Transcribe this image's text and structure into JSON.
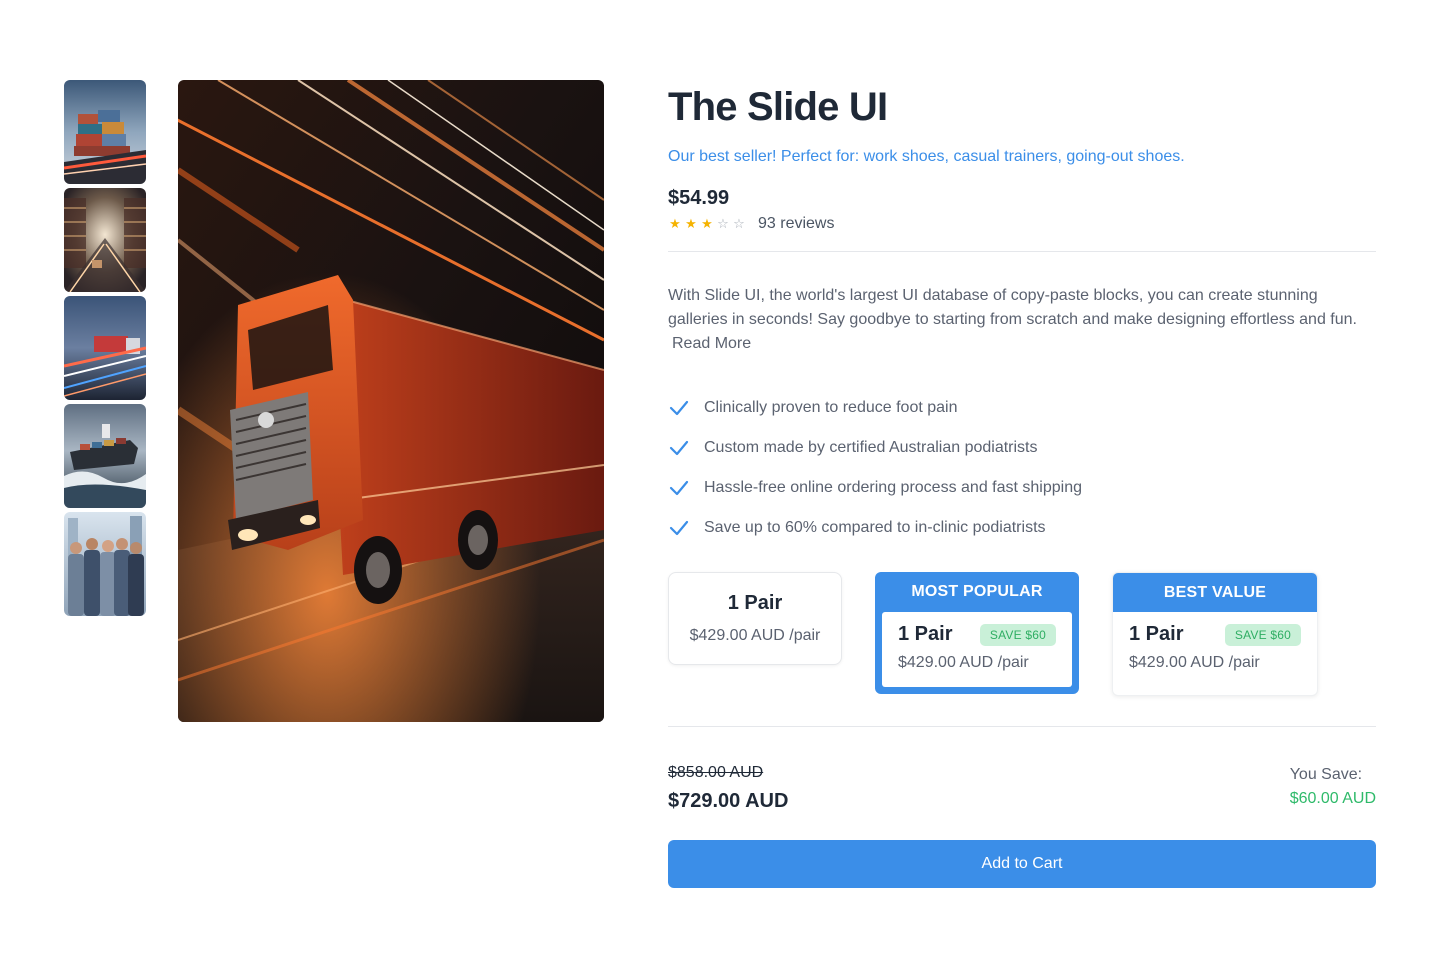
{
  "product": {
    "title": "The Slide UI",
    "tagline": "Our best seller! Perfect for: work shoes, casual trainers, going-out shoes.",
    "price": "$54.99",
    "rating": 3,
    "rating_max": 5,
    "reviews": "93 reviews",
    "description": "With Slide UI, the world's largest UI database of copy-paste blocks, you can create stunning galleries in seconds! Say goodbye to starting from scratch and make designing effortless and fun.",
    "read_more": "Read More"
  },
  "gallery": {
    "thumbnails": [
      {
        "name": "shipping containers"
      },
      {
        "name": "warehouse"
      },
      {
        "name": "trucks at night"
      },
      {
        "name": "cargo ship"
      },
      {
        "name": "team of workers"
      }
    ],
    "main": {
      "name": "orange truck on highway"
    }
  },
  "features": [
    "Clinically proven to reduce foot pain",
    "Custom made by certified Australian podiatrists",
    "Hassle-free online ordering process and fast shipping",
    "Save up to 60% compared to in-clinic podiatrists"
  ],
  "options": [
    {
      "header": "",
      "quantity": "1 Pair",
      "price": "$429.00 AUD /pair",
      "badge": "",
      "selected": false
    },
    {
      "header": "MOST POPULAR",
      "quantity": "1 Pair",
      "price": "$429.00 AUD /pair",
      "badge": "SAVE $60",
      "selected": true
    },
    {
      "header": "BEST VALUE",
      "quantity": "1 Pair",
      "price": "$429.00 AUD /pair",
      "badge": "SAVE $60",
      "selected": false
    }
  ],
  "totals": {
    "original": "$858.00 AUD",
    "final": "$729.00 AUD",
    "save_label": "You Save:",
    "save_amount": "$60.00 AUD"
  },
  "cart_button": "Add to Cart",
  "colors": {
    "accent": "#3b8ee8",
    "star": "#f5b301",
    "savings": "#2fba6a",
    "badge_bg": "#c9f0d8"
  },
  "icons": {
    "feature": "check-icon",
    "star": "star-icon"
  }
}
